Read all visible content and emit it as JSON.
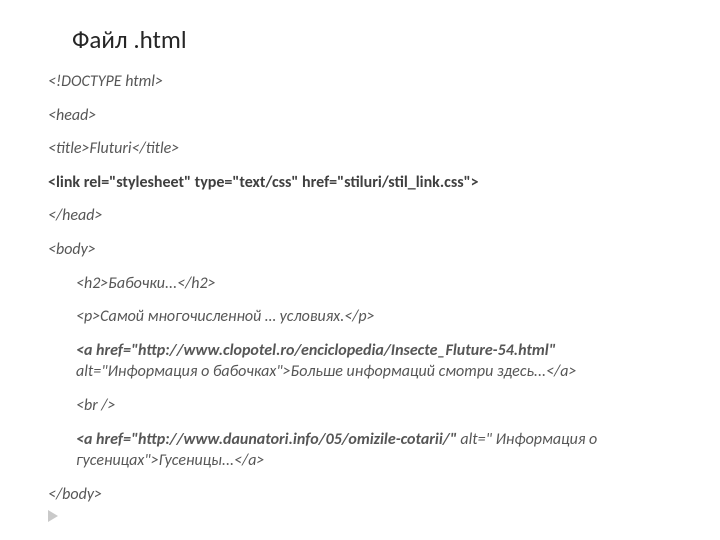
{
  "heading": {
    "bullet": "",
    "text": "Файл .html"
  },
  "code": {
    "l1": "<!DOCTYPE html>",
    "l2": "<head>",
    "l3": "<title>Fluturi</title>",
    "l4": "<link rel=\"stylesheet\" type=\"text/css\" href=\"stiluri/stil_link.css\">",
    "l5": "</head>",
    "l6": "<body>",
    "l7": "<h2>Бабочки...</h2>",
    "l8": "<p>Самой многочисленной … условиях.</p>",
    "l9a": "<a href=\"http://www.clopotel.ro/enciclopedia/Insecte_Fluture-54.html\" ",
    "l9b": "alt=\"Информация о бабочках\">",
    "l9c": "Больше информаций смотри здесь...</a>",
    "l10": "<br />",
    "l11a": "<a href=\"http://www.daunatori.info/05/omizile-cotarii/\" ",
    "l11b": "alt=\" Информация о гусеницах\">",
    "l11c": "Гусеницы...</a>",
    "l12": "</body>"
  }
}
